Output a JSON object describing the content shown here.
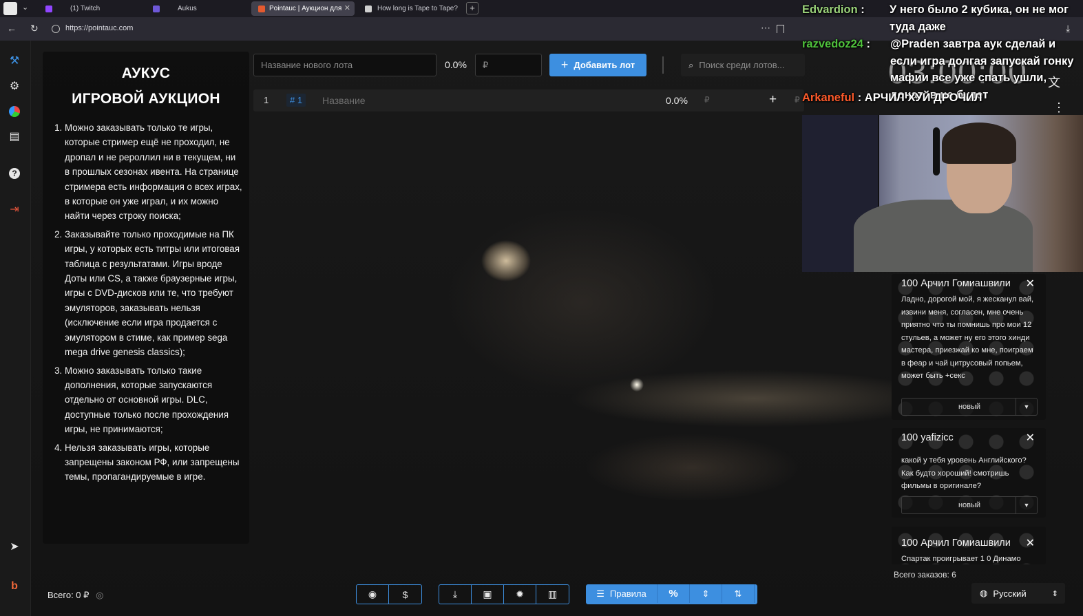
{
  "browser": {
    "tabs": [
      {
        "label": "(1) Twitch",
        "color": "#9146ff",
        "active": false
      },
      {
        "label": "Aukus",
        "color": "#6e58d8",
        "active": false
      },
      {
        "label": "Pointauc | Аукцион для",
        "color": "#e45a2f",
        "active": true
      },
      {
        "label": "How long is Tape to Tape?",
        "color": "#d0d0d0",
        "active": false
      }
    ],
    "url": "https://pointauc.com"
  },
  "rules": {
    "title_line1": "АУКУС",
    "title_line2": "ИГРОВОЙ АУКЦИОН",
    "items": [
      "Можно заказывать только те игры, которые стример ещё не проходил, не дропал и не рероллил ни в текущем, ни в прошлых сезонах ивента. На странице стримера есть информация о всех играх, в которые он уже играл, и их можно найти через строку поиска;",
      "Заказывайте только проходимые на ПК игры, у которых есть титры или итоговая таблица с результатами. Игры вроде Доты или CS, а также браузерные игры, игры с DVD-дисков или те, что требуют эмуляторов, заказывать нельзя (исключение если игра продается с эмулятором в стиме, как пример sega mega drive genesis classics);",
      "Можно заказывать только такие дополнения, которые запускаются отдельно от основной игры. DLC, доступные только после прохождения игры, не принимаются;",
      "Нельзя заказывать игры, которые запрещены законом РФ, или запрещены темы, пропагандируемые в игре."
    ]
  },
  "controls": {
    "new_lot_placeholder": "Название нового лота",
    "percent": "0.0%",
    "amount_placeholder": "₽",
    "add_lot_label": "Добавить лот",
    "search_placeholder": "Поиск среди лотов..."
  },
  "lot": {
    "index": "1",
    "tag": "# 1",
    "name_placeholder": "Название",
    "percent": "0.0%",
    "currency": "₽"
  },
  "overlay": {
    "chat": [
      {
        "user": "Edvardion",
        "color": "#9ad27a",
        "text": "У него было 2 кубика, он не мог туда даже"
      },
      {
        "user": "razvedoz24",
        "color": "#4fc23c",
        "text": "@Praden завтра аук сделай и если игра долгая запускай гонку мафии все уже спать ушли, донатов не будет"
      },
      {
        "user": "Arkaneful",
        "color": "#ff5a2a",
        "text": "АРЧИЛ ХУЙ ДРОЧИЛ"
      }
    ],
    "clock": "03:00:00"
  },
  "orders": [
    {
      "amount": "100",
      "name": "Арчил Гомиашвили",
      "message": "Ладно, дорогой мой, я жесканул вай, извини меня, согласен, мне очень приятно что ты помнишь про мои 12 стульев, а может ну его этого хинди мастера, приезжай ко мне, поиграем в феар и чай цитрусовый попьем, может быть +секс",
      "status": "новый"
    },
    {
      "amount": "100",
      "name": "yafizicc",
      "message": "какой у тебя уровень Английского? Как будто хороший! смотришь фильмы в оригинале?",
      "status": "новый"
    },
    {
      "amount": "100",
      "name": "Арчил Гомиашвили",
      "message": "Спартак проигрывает 1 0 Динамо",
      "status": ""
    }
  ],
  "orders_total": "Всего заказов: 6",
  "footer": {
    "total": "Всего: 0 ₽",
    "rules_label": "Правила",
    "language": "Русский"
  }
}
